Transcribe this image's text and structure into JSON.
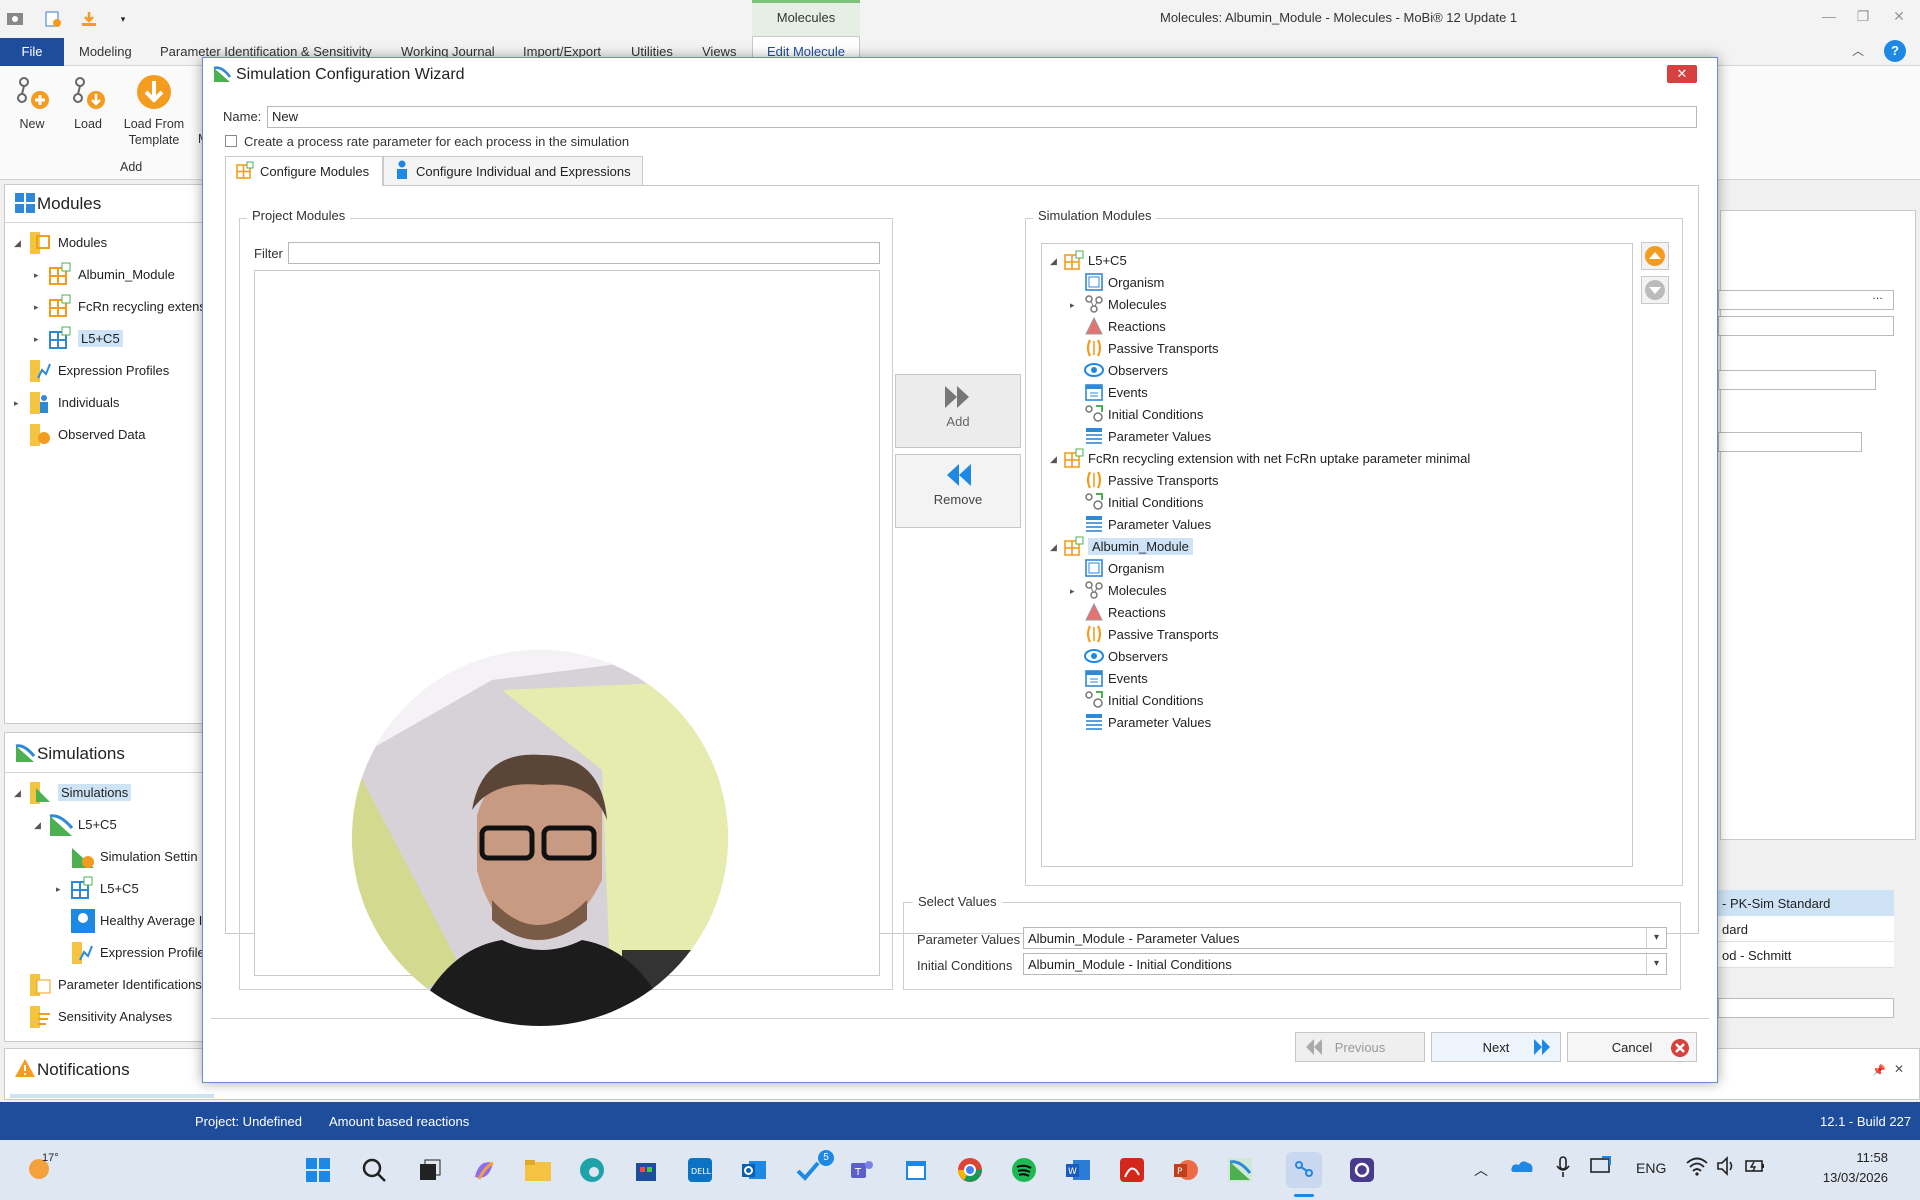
{
  "window": {
    "title": "Molecules: Albumin_Module - Molecules - MoBi® 12 Update 1",
    "context_tab": "Molecules"
  },
  "ribbon": {
    "tabs": [
      "File",
      "Modeling",
      "Parameter Identification & Sensitivity",
      "Working Journal",
      "Import/Export",
      "Utilities",
      "Views",
      "Edit Molecule"
    ],
    "buttons": {
      "new": "New",
      "load": "Load",
      "load_template_line1": "Load From",
      "load_template_line2": "Template",
      "partial_label": "M"
    },
    "group_label": "Add"
  },
  "modules_panel": {
    "header": "Modules",
    "items": [
      "Modules",
      "Albumin_Module",
      "FcRn recycling extens",
      "L5+C5",
      "Expression Profiles",
      "Individuals",
      "Observed Data"
    ]
  },
  "simulations_panel": {
    "header": "Simulations",
    "items": [
      "Simulations",
      "L5+C5",
      "Simulation Settin",
      "L5+C5",
      "Healthy Average I",
      "Expression Profile",
      "Parameter Identifications",
      "Sensitivity Analyses"
    ]
  },
  "notifications": {
    "header": "Notifications"
  },
  "right_background": {
    "list": [
      "- PK-Sim Standard",
      "dard",
      "od - Schmitt"
    ]
  },
  "dialog": {
    "title": "Simulation Configuration Wizard",
    "close": "✕",
    "name_label": "Name:",
    "name_value": "New",
    "checkbox_label": "Create a process rate parameter for each process in the simulation",
    "tabs": [
      "Configure Modules",
      "Configure Individual and Expressions"
    ],
    "project_modules": {
      "title": "Project Modules",
      "filter_label": "Filter",
      "filter_value": ""
    },
    "add_label": "Add",
    "remove_label": "Remove",
    "simulation_modules": {
      "title": "Simulation Modules",
      "tree": [
        {
          "label": "L5+C5",
          "level": 0,
          "icon": "module-icon"
        },
        {
          "label": "Organism",
          "level": 1,
          "icon": "organism-icon"
        },
        {
          "label": "Molecules",
          "level": 1,
          "icon": "molecules-icon"
        },
        {
          "label": "Reactions",
          "level": 1,
          "icon": "reactions-icon"
        },
        {
          "label": "Passive Transports",
          "level": 1,
          "icon": "passive-transport-icon"
        },
        {
          "label": "Observers",
          "level": 1,
          "icon": "observers-icon"
        },
        {
          "label": "Events",
          "level": 1,
          "icon": "events-icon"
        },
        {
          "label": "Initial Conditions",
          "level": 1,
          "icon": "initial-conditions-icon"
        },
        {
          "label": "Parameter Values",
          "level": 1,
          "icon": "parameter-values-icon"
        },
        {
          "label": "FcRn recycling extension with net FcRn uptake parameter minimal",
          "level": 0,
          "icon": "module-icon"
        },
        {
          "label": "Passive Transports",
          "level": 1,
          "icon": "passive-transport-icon"
        },
        {
          "label": "Initial Conditions",
          "level": 1,
          "icon": "initial-conditions-icon"
        },
        {
          "label": "Parameter Values",
          "level": 1,
          "icon": "parameter-values-icon"
        },
        {
          "label": "Albumin_Module",
          "level": 0,
          "icon": "module-icon"
        },
        {
          "label": "Organism",
          "level": 1,
          "icon": "organism-icon"
        },
        {
          "label": "Molecules",
          "level": 1,
          "icon": "molecules-icon"
        },
        {
          "label": "Reactions",
          "level": 1,
          "icon": "reactions-icon"
        },
        {
          "label": "Passive Transports",
          "level": 1,
          "icon": "passive-transport-icon"
        },
        {
          "label": "Observers",
          "level": 1,
          "icon": "observers-icon"
        },
        {
          "label": "Events",
          "level": 1,
          "icon": "events-icon"
        },
        {
          "label": "Initial Conditions",
          "level": 1,
          "icon": "initial-conditions-icon"
        },
        {
          "label": "Parameter Values",
          "level": 1,
          "icon": "parameter-values-icon"
        }
      ]
    },
    "select_values": {
      "title": "Select Values",
      "parameter_values_label": "Parameter Values",
      "parameter_values_value": "Albumin_Module - Parameter Values",
      "initial_conditions_label": "Initial Conditions",
      "initial_conditions_value": "Albumin_Module - Initial Conditions"
    },
    "buttons": {
      "previous": "Previous",
      "next": "Next",
      "cancel": "Cancel"
    }
  },
  "statusbar": {
    "project": "Project: Undefined",
    "reactions": "Amount based reactions",
    "version": "12.1 - Build 227"
  },
  "taskbar": {
    "weather": "17°",
    "language": "ENG",
    "time": "11:58",
    "date": "13/03/2026",
    "todo_badge": "5"
  },
  "colors": {
    "accent": "#1e4d9c",
    "orange": "#f39c1f",
    "close_red": "#d64140",
    "highlight": "#cfe3f7"
  }
}
